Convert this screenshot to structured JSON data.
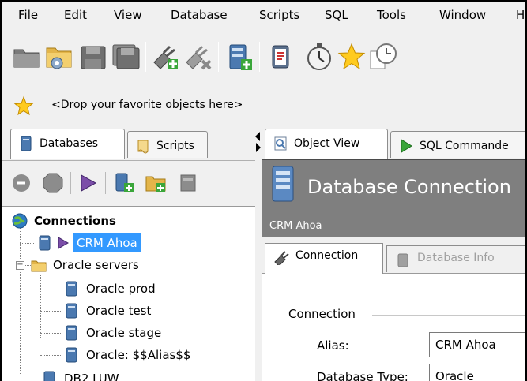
{
  "menubar": {
    "items": [
      "File",
      "Edit",
      "View",
      "Database",
      "Scripts",
      "SQL",
      "Tools",
      "Window",
      "H"
    ]
  },
  "toolbar": {
    "icons": [
      "open-folder-icon",
      "open-folder-gear-icon",
      "save-icon",
      "save-all-icon",
      "connect-plug-icon",
      "disconnect-plug-icon",
      "new-database-icon",
      "clipboard-icon",
      "stopwatch-icon",
      "favorite-star-icon",
      "history-clock-icon"
    ]
  },
  "favorites": {
    "placeholder": "<Drop your favorite objects here>"
  },
  "left_tabs": [
    {
      "label": "Databases",
      "active": true
    },
    {
      "label": "Scripts",
      "active": false
    }
  ],
  "tree": {
    "root": "Connections",
    "selected": "CRM Ahoa",
    "folder": "Oracle servers",
    "children": [
      "Oracle prod",
      "Oracle test",
      "Oracle stage",
      "Oracle: $$Alias$$"
    ],
    "next": "DB2 LUW"
  },
  "right_tabs": [
    {
      "label": "Object View",
      "active": true
    },
    {
      "label": "SQL Commande",
      "active": false
    }
  ],
  "header": {
    "title": "Database Connection",
    "subtitle": "CRM Ahoa"
  },
  "sub_tabs": [
    {
      "label": "Connection",
      "active": true,
      "enabled": true
    },
    {
      "label": "Database Info",
      "active": false,
      "enabled": false
    }
  ],
  "form": {
    "group_title": "Connection",
    "alias_label": "Alias:",
    "alias_value": "CRM Ahoa",
    "dbtype_label": "Database Type:",
    "dbtype_value": "Oracle"
  },
  "colors": {
    "selection": "#3399ff",
    "header_bg": "#7f7f7f"
  }
}
